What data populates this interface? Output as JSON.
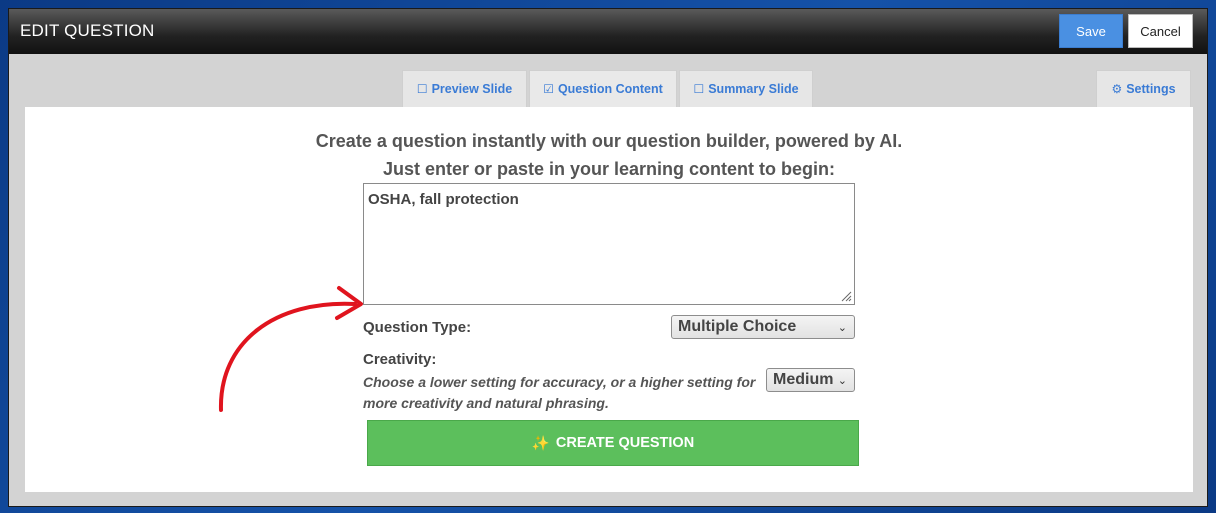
{
  "header": {
    "title": "EDIT QUESTION",
    "save_label": "Save",
    "cancel_label": "Cancel"
  },
  "tabs": [
    {
      "label": "Preview Slide",
      "icon": "square-icon",
      "active": false
    },
    {
      "label": "Question Content",
      "icon": "checked-square-icon",
      "active": true
    },
    {
      "label": "Summary Slide",
      "icon": "square-icon",
      "active": false
    }
  ],
  "settings_tab": {
    "label": "Settings",
    "icon": "gear-icon"
  },
  "builder": {
    "heading_line1": "Create a question instantly with our question builder, powered by AI.",
    "heading_line2": "Just enter or paste in your learning content to begin:",
    "content_value": "OSHA, fall protection",
    "question_type_label": "Question Type:",
    "question_type_value": "Multiple Choice",
    "creativity_label": "Creativity:",
    "creativity_hint": "Choose a lower setting for accuracy, or a higher setting for more creativity and natural phrasing.",
    "creativity_value": "Medium",
    "create_button_label": "CREATE QUESTION",
    "create_button_icon": "sparkle-icon"
  },
  "colors": {
    "accent_blue": "#4a90e2",
    "tab_text": "#3a7bd5",
    "create_green": "#5cbf5c",
    "arrow_red": "#e0141e"
  }
}
